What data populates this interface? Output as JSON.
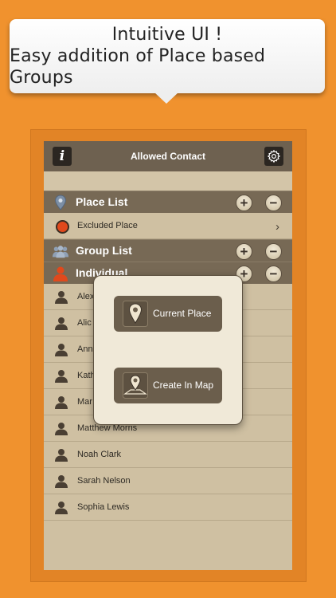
{
  "promo": {
    "line1": "Intuitive UI !",
    "line2": "Easy addition of Place based Groups"
  },
  "app": {
    "title": "Allowed Contact",
    "info_label": "i",
    "colors": {
      "background": "#F0922E",
      "navbar": "#6E6150",
      "section": "#776955",
      "list": "#CFC0A2",
      "excluded": "#E0491C",
      "popup": "#F0E9D8"
    }
  },
  "sections": {
    "place": {
      "label": "Place List",
      "icon": "pin-icon"
    },
    "group": {
      "label": "Group List",
      "icon": "group-icon"
    },
    "individual": {
      "label": "Individual",
      "icon": "person-icon"
    }
  },
  "place_rows": [
    {
      "label": "Excluded Place"
    }
  ],
  "contacts": [
    {
      "name": "Alex"
    },
    {
      "name": "Alic"
    },
    {
      "name": "Ann"
    },
    {
      "name": "Kath"
    },
    {
      "name": "Mar"
    },
    {
      "name": "Matthew Morris"
    },
    {
      "name": "Noah Clark"
    },
    {
      "name": "Sarah Nelson"
    },
    {
      "name": "Sophia Lewis"
    }
  ],
  "popup": {
    "current_place": "Current Place",
    "create_in_map": "Create In Map"
  },
  "buttons": {
    "plus": "+",
    "minus": "−"
  }
}
